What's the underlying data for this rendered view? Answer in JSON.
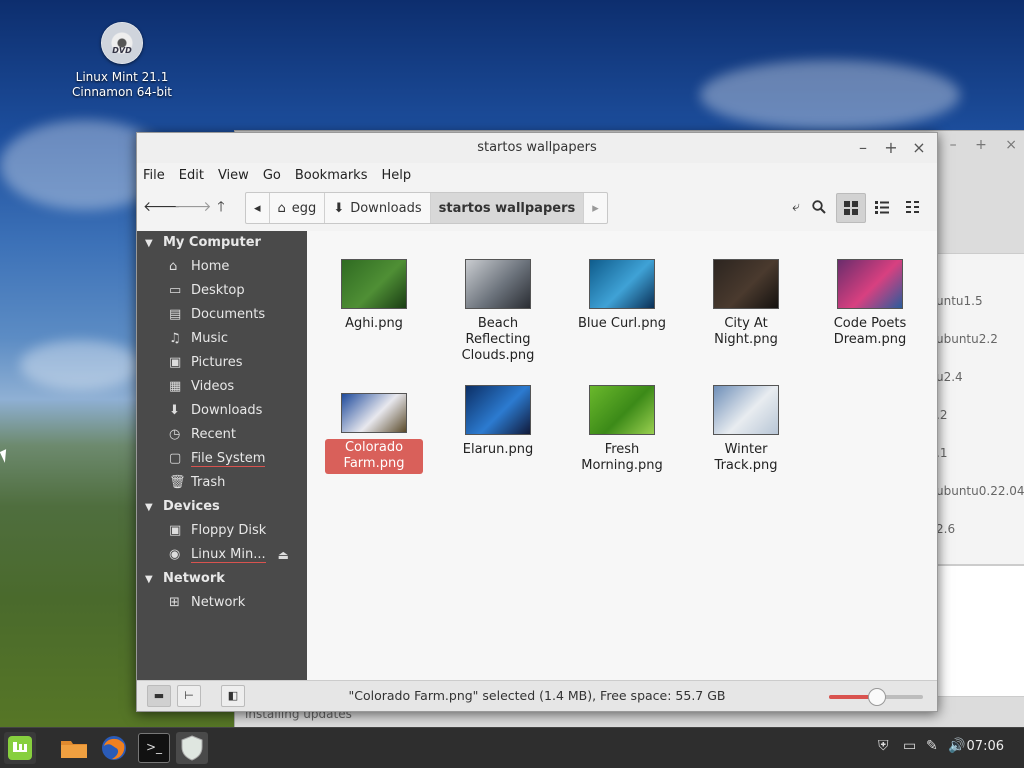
{
  "desktop": {
    "icon_line1": "Linux Mint 21.1",
    "icon_line2": "Cinnamon 64-bit",
    "dvd_label": "DVD"
  },
  "background_window": {
    "items": [
      "untu1.5",
      "ubuntu2.2",
      "u2.4",
      ".2",
      ".1",
      "ubuntu0.22.04.",
      "2.6"
    ],
    "status": "installing updates"
  },
  "window": {
    "title": "startos wallpapers",
    "menu": [
      "File",
      "Edit",
      "View",
      "Go",
      "Bookmarks",
      "Help"
    ],
    "breadcrumbs": [
      {
        "label": "egg",
        "icon": "home-icon"
      },
      {
        "label": "Downloads",
        "icon": "download-icon"
      },
      {
        "label": "startos wallpapers"
      }
    ]
  },
  "sidebar": {
    "sections": [
      {
        "title": "My Computer",
        "items": [
          {
            "label": "Home",
            "icon": "home-icon"
          },
          {
            "label": "Desktop",
            "icon": "desktop-icon"
          },
          {
            "label": "Documents",
            "icon": "documents-icon"
          },
          {
            "label": "Music",
            "icon": "music-icon"
          },
          {
            "label": "Pictures",
            "icon": "pictures-icon"
          },
          {
            "label": "Videos",
            "icon": "videos-icon"
          },
          {
            "label": "Downloads",
            "icon": "download-icon"
          },
          {
            "label": "Recent",
            "icon": "recent-icon"
          },
          {
            "label": "File System",
            "icon": "drive-icon"
          },
          {
            "label": "Trash",
            "icon": "trash-icon"
          }
        ]
      },
      {
        "title": "Devices",
        "items": [
          {
            "label": "Floppy Disk",
            "icon": "floppy-icon"
          },
          {
            "label": "Linux Min...",
            "icon": "disc-icon"
          }
        ]
      },
      {
        "title": "Network",
        "items": [
          {
            "label": "Network",
            "icon": "network-icon"
          }
        ]
      }
    ]
  },
  "files": [
    {
      "name": "Aghi.png",
      "selected": false,
      "colors": [
        "#2f6b22",
        "#4f8f35",
        "#1a3d14"
      ]
    },
    {
      "name": "Beach Reflecting Clouds.png",
      "selected": false,
      "colors": [
        "#c9ccd0",
        "#6c737c",
        "#2a2d33"
      ]
    },
    {
      "name": "Blue Curl.png",
      "selected": false,
      "colors": [
        "#0f5c8c",
        "#3fa2d6",
        "#0a2f55"
      ]
    },
    {
      "name": "City At Night.png",
      "selected": false,
      "colors": [
        "#2c2520",
        "#4a3a2e",
        "#151210"
      ]
    },
    {
      "name": "Code Poets Dream.png",
      "selected": false,
      "colors": [
        "#6a2d6c",
        "#d84080",
        "#2a5c9c"
      ]
    },
    {
      "name": "Colorado Farm.png",
      "selected": true,
      "colors": [
        "#1e4a9c",
        "#e8e8ee",
        "#5a4a2a"
      ]
    },
    {
      "name": "Elarun.png",
      "selected": false,
      "colors": [
        "#0c2f66",
        "#2c7bd0",
        "#111a3a"
      ]
    },
    {
      "name": "Fresh Morning.png",
      "selected": false,
      "colors": [
        "#6ab82c",
        "#3c8a18",
        "#9ad050"
      ]
    },
    {
      "name": "Winter Track.png",
      "selected": false,
      "colors": [
        "#6f8fb8",
        "#e8ecf0",
        "#b8c6d6"
      ]
    }
  ],
  "status": {
    "text": "\"Colorado Farm.png\" selected (1.4 MB), Free space: 55.7 GB",
    "zoom_fraction": 0.5
  },
  "taskbar": {
    "clock": "07:06"
  },
  "colors": {
    "accent": "#d9605a",
    "sidebar_bg": "#4a4a4a"
  }
}
